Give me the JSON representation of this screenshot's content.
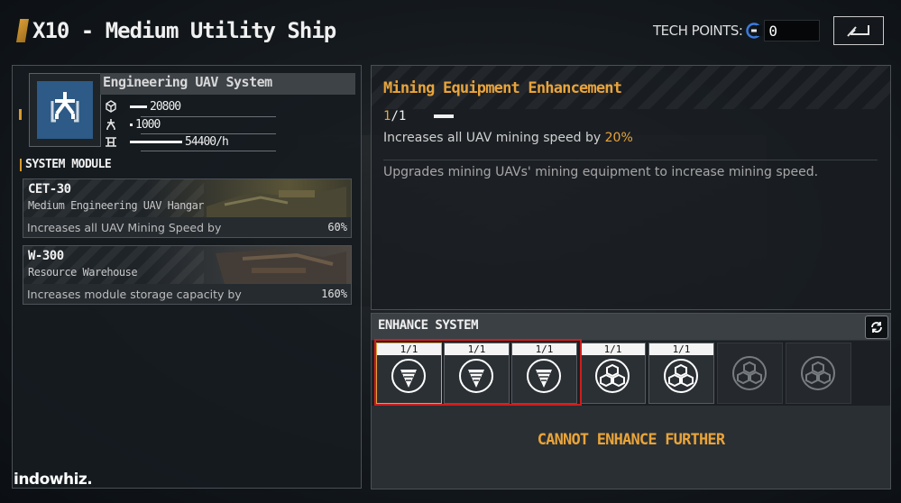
{
  "header": {
    "title": "X10 - Medium Utility Ship",
    "tech_points_label": "TECH POINTS:",
    "tech_points_value": "0"
  },
  "system": {
    "name": "Engineering UAV System",
    "stats": [
      {
        "icon": "cube-icon",
        "value": "20800"
      },
      {
        "icon": "uav-icon",
        "value": "1000"
      },
      {
        "icon": "mining-rate-icon",
        "value": "54400/h"
      }
    ]
  },
  "modules": {
    "title": "SYSTEM MODULE",
    "items": [
      {
        "code": "CET-30",
        "name": "Medium Engineering UAV Hangar",
        "desc": "Increases all UAV Mining Speed by",
        "value": "60%"
      },
      {
        "code": "W-300",
        "name": "Resource Warehouse",
        "desc": "Increases module storage capacity by",
        "value": "160%"
      }
    ]
  },
  "enhancement": {
    "title": "Mining Equipment Enhancement",
    "level_current": "1",
    "level_max": "/1",
    "effect_text": "Increases all UAV mining speed by ",
    "effect_value": "20%",
    "description": "Upgrades mining UAVs' mining equipment to increase mining speed."
  },
  "enhance_system": {
    "title": "ENHANCE SYSTEM",
    "slots": [
      {
        "level": "1/1",
        "icon": "drill-icon",
        "state": "active"
      },
      {
        "level": "1/1",
        "icon": "drill-icon",
        "state": "done"
      },
      {
        "level": "1/1",
        "icon": "drill-icon",
        "state": "done"
      },
      {
        "level": "1/1",
        "icon": "cubes-icon",
        "state": "done"
      },
      {
        "level": "1/1",
        "icon": "cubes-icon",
        "state": "done"
      },
      {
        "level": "",
        "icon": "cubes-icon",
        "state": "locked"
      },
      {
        "level": "",
        "icon": "cubes-icon",
        "state": "locked"
      }
    ],
    "status": "CANNOT ENHANCE FURTHER"
  },
  "watermark": "indowhiz.",
  "colors": {
    "accent": "#e9a43a",
    "selection": "#cf1d1d",
    "icon_bg": "#2d5a86"
  }
}
